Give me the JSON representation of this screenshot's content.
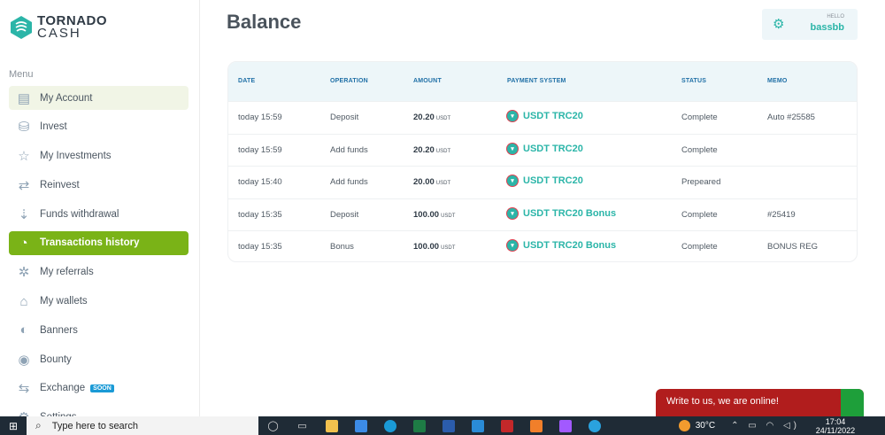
{
  "logo": {
    "line1": "TORNADO",
    "line2": "CASH"
  },
  "sidebar": {
    "menu_title": "Menu",
    "items": [
      {
        "label": "My Account",
        "icon": "account-icon",
        "glyph": "▤"
      },
      {
        "label": "Invest",
        "icon": "invest-icon",
        "glyph": "⛁"
      },
      {
        "label": "My Investments",
        "icon": "star-icon",
        "glyph": "☆"
      },
      {
        "label": "Reinvest",
        "icon": "reinvest-icon",
        "glyph": "⇄"
      },
      {
        "label": "Funds withdrawal",
        "icon": "withdrawal-icon",
        "glyph": "⇣"
      },
      {
        "label": "Transactions history",
        "icon": "history-icon",
        "glyph": "◔"
      },
      {
        "label": "My referrals",
        "icon": "referrals-icon",
        "glyph": "✲"
      },
      {
        "label": "My wallets",
        "icon": "wallet-icon",
        "glyph": "⌂"
      },
      {
        "label": "Banners",
        "icon": "banners-icon",
        "glyph": "◐"
      },
      {
        "label": "Bounty",
        "icon": "bounty-icon",
        "glyph": "◉"
      },
      {
        "label": "Exchange",
        "icon": "exchange-icon",
        "glyph": "⇆",
        "badge": "SOON"
      },
      {
        "label": "Settings",
        "icon": "settings-icon",
        "glyph": "⚙"
      }
    ]
  },
  "main": {
    "title": "Balance"
  },
  "user": {
    "greeting": "HELLO",
    "name": "bassbb"
  },
  "table": {
    "headers": [
      "DATE",
      "OPERATION",
      "AMOUNT",
      "PAYMENT SYSTEM",
      "STATUS",
      "MEMO"
    ],
    "rows": [
      {
        "date": "today 15:59",
        "operation": "Deposit",
        "amount": "20.20",
        "currency": "USDT",
        "payment": "USDT TRC20",
        "status": "Complete",
        "memo": "Auto #25585"
      },
      {
        "date": "today 15:59",
        "operation": "Add funds",
        "amount": "20.20",
        "currency": "USDT",
        "payment": "USDT TRC20",
        "status": "Complete",
        "memo": ""
      },
      {
        "date": "today 15:40",
        "operation": "Add funds",
        "amount": "20.00",
        "currency": "USDT",
        "payment": "USDT TRC20",
        "status": "Prepeared",
        "memo": ""
      },
      {
        "date": "today 15:35",
        "operation": "Deposit",
        "amount": "100.00",
        "currency": "USDT",
        "payment": "USDT TRC20 Bonus",
        "status": "Complete",
        "memo": "#25419"
      },
      {
        "date": "today 15:35",
        "operation": "Bonus",
        "amount": "100.00",
        "currency": "USDT",
        "payment": "USDT TRC20 Bonus",
        "status": "Complete",
        "memo": "BONUS REG"
      }
    ]
  },
  "chat": {
    "text": "Write to us, we are online!"
  },
  "taskbar": {
    "search_placeholder": "Type here to search",
    "weather": "30°C",
    "time": "17:04",
    "date": "24/11/2022",
    "apps": [
      {
        "name": "task-view-icon",
        "color": "#2f3b47"
      },
      {
        "name": "file-explorer-icon",
        "color": "#f2c14e"
      },
      {
        "name": "store-icon",
        "color": "#3c8be6"
      },
      {
        "name": "edge-icon",
        "color": "#1a9ad6"
      },
      {
        "name": "excel-icon",
        "color": "#1e7b45"
      },
      {
        "name": "word-icon",
        "color": "#2b5cab"
      },
      {
        "name": "vscode-icon",
        "color": "#2a8bd6"
      },
      {
        "name": "filezilla-icon",
        "color": "#c3282a"
      },
      {
        "name": "xampp-icon",
        "color": "#f17f2a"
      },
      {
        "name": "figma-icon",
        "color": "#a259ff"
      },
      {
        "name": "telegram-icon",
        "color": "#2aa2de"
      }
    ]
  }
}
